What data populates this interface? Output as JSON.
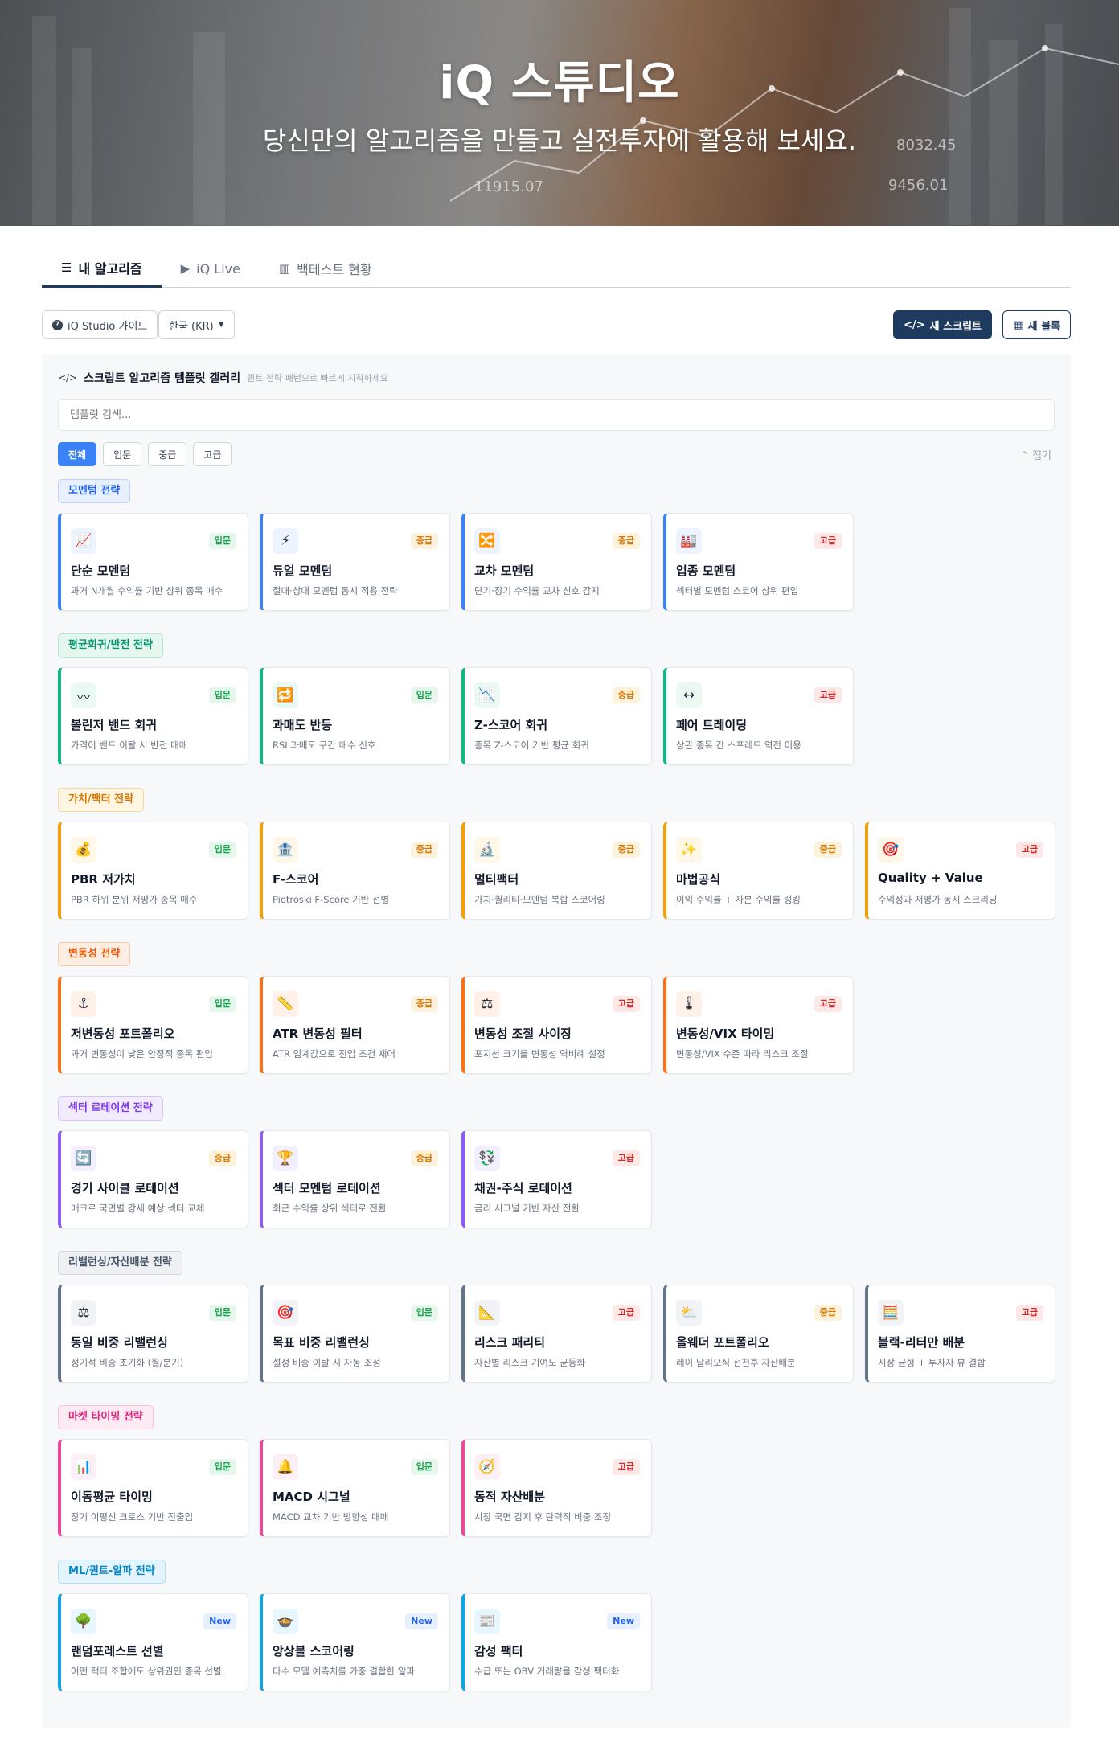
{
  "hero": {
    "title": "iQ 스튜디오",
    "subtitle": "당신만의 알고리즘을 만들고 실전투자에 활용해 보세요.",
    "bg_numbers": [
      "8032.45",
      "11915.07",
      "9456.01"
    ]
  },
  "tabs": [
    {
      "label": "내 알고리즘",
      "icon": "list-icon",
      "glyph": "☰"
    },
    {
      "label": "iQ Live",
      "icon": "play-circle-icon",
      "glyph": "▶"
    },
    {
      "label": "백테스트 현황",
      "icon": "bar-chart-icon",
      "glyph": "📊"
    }
  ],
  "toolbar": {
    "guide_label": "iQ Studio 가이드",
    "market_label": "한국 (KR)",
    "new_script_label": "새 스크립트",
    "new_block_label": "새 블록"
  },
  "gallery": {
    "title": "스크립트 알고리즘 템플릿 갤러리",
    "subtitle": "퀀트 전략 패턴으로 빠르게 시작하세요",
    "search_placeholder": "템플릿 검색...",
    "filters": [
      "전체",
      "입문",
      "중급",
      "고급"
    ],
    "collapse_label": "접기"
  },
  "colors": {
    "momentum": "#3b82f6",
    "mean_reversion": "#10b981",
    "value": "#f59e0b",
    "volatility": "#f97316",
    "sector": "#8b5cf6",
    "rebalance": "#64748b",
    "timing": "#ec4899",
    "ml": "#0ea5e9"
  },
  "categories": [
    {
      "name": "모멘텀 전략",
      "theme": "momentum",
      "cards": [
        {
          "icon": "chart-increasing-icon",
          "glyph": "📈",
          "level": "입문",
          "lv": "basic",
          "title": "단순 모멘텀",
          "desc": "과거 N개월 수익률 기반 상위 종목 매수"
        },
        {
          "icon": "lightning-icon",
          "glyph": "⚡",
          "level": "중급",
          "lv": "mid",
          "title": "듀얼 모멘텀",
          "desc": "절대·상대 모멘텀 동시 적용 전략"
        },
        {
          "icon": "shuffle-icon",
          "glyph": "🔀",
          "level": "중급",
          "lv": "mid",
          "title": "교차 모멘텀",
          "desc": "단기·장기 수익률 교차 신호 감지"
        },
        {
          "icon": "factory-icon",
          "glyph": "🏭",
          "level": "고급",
          "lv": "adv",
          "title": "업종 모멘텀",
          "desc": "섹터별 모멘텀 스코어 상위 편입"
        }
      ]
    },
    {
      "name": "평균회귀/반전 전략",
      "theme": "mean_reversion",
      "cards": [
        {
          "icon": "wave-icon",
          "glyph": "〰",
          "level": "입문",
          "lv": "basic",
          "title": "볼린저 밴드 회귀",
          "desc": "가격이 밴드 이탈 시 반전 매매"
        },
        {
          "icon": "repeat-icon",
          "glyph": "🔁",
          "level": "입문",
          "lv": "basic",
          "title": "과매도 반등",
          "desc": "RSI 과매도 구간 매수 신호"
        },
        {
          "icon": "chart-decreasing-icon",
          "glyph": "📉",
          "level": "중급",
          "lv": "mid",
          "title": "Z-스코어 회귀",
          "desc": "종목 Z-스코어 기반 평균 회귀"
        },
        {
          "icon": "left-right-arrow-icon",
          "glyph": "↔",
          "level": "고급",
          "lv": "adv",
          "title": "페어 트레이딩",
          "desc": "상관 종목 간 스프레드 역전 이용"
        }
      ]
    },
    {
      "name": "가치/팩터 전략",
      "theme": "value",
      "cards": [
        {
          "icon": "money-bag-icon",
          "glyph": "💰",
          "level": "입문",
          "lv": "basic",
          "title": "PBR 저가치",
          "desc": "PBR 하위 분위 저평가 종목 매수"
        },
        {
          "icon": "bank-icon",
          "glyph": "🏦",
          "level": "중급",
          "lv": "mid",
          "title": "F-스코어",
          "desc": "Piotroski F-Score 기반 선별"
        },
        {
          "icon": "microscope-icon",
          "glyph": "🔬",
          "level": "중급",
          "lv": "mid",
          "title": "멀티팩터",
          "desc": "가치·퀄리티·모멘텀 복합 스코어링"
        },
        {
          "icon": "sparkles-icon",
          "glyph": "✨",
          "level": "중급",
          "lv": "mid",
          "title": "마법공식",
          "desc": "이익 수익률 + 자본 수익률 랭킹"
        },
        {
          "icon": "target-icon",
          "glyph": "🎯",
          "level": "고급",
          "lv": "adv",
          "title": "Quality + Value",
          "desc": "수익성과 저평가 동시 스크리닝"
        }
      ]
    },
    {
      "name": "변동성 전략",
      "theme": "volatility",
      "cards": [
        {
          "icon": "anchor-icon",
          "glyph": "⚓",
          "level": "입문",
          "lv": "basic",
          "title": "저변동성 포트폴리오",
          "desc": "과거 변동성이 낮은 안정적 종목 편입"
        },
        {
          "icon": "ruler-icon",
          "glyph": "📏",
          "level": "중급",
          "lv": "mid",
          "title": "ATR 변동성 필터",
          "desc": "ATR 임계값으로 진입 조건 제어"
        },
        {
          "icon": "balance-scale-icon",
          "glyph": "⚖",
          "level": "고급",
          "lv": "adv",
          "title": "변동성 조절 사이징",
          "desc": "포지션 크기를 변동성 역비례 설정"
        },
        {
          "icon": "thermometer-icon",
          "glyph": "🌡",
          "level": "고급",
          "lv": "adv",
          "title": "변동성/VIX 타이밍",
          "desc": "변동성/VIX 수준 따라 리스크 조절"
        }
      ]
    },
    {
      "name": "섹터 로테이션 전략",
      "theme": "sector",
      "cards": [
        {
          "icon": "cycle-arrows-icon",
          "glyph": "🔄",
          "level": "중급",
          "lv": "mid",
          "title": "경기 사이클 로테이션",
          "desc": "매크로 국면별 강세 예상 섹터 교체"
        },
        {
          "icon": "trophy-icon",
          "glyph": "🏆",
          "level": "중급",
          "lv": "mid",
          "title": "섹터 모멘텀 로테이션",
          "desc": "최근 수익률 상위 섹터로 전환"
        },
        {
          "icon": "currency-exchange-icon",
          "glyph": "💱",
          "level": "고급",
          "lv": "adv",
          "title": "채권-주식 로테이션",
          "desc": "금리 시그널 기반 자산 전환"
        }
      ]
    },
    {
      "name": "리밸런싱/자산배분 전략",
      "theme": "rebalance",
      "cards": [
        {
          "icon": "balance-scale-icon",
          "glyph": "⚖",
          "level": "입문",
          "lv": "basic",
          "title": "동일 비중 리밸런싱",
          "desc": "정기적 비중 초기화 (월/분기)"
        },
        {
          "icon": "target-icon",
          "glyph": "🎯",
          "level": "입문",
          "lv": "basic",
          "title": "목표 비중 리밸런싱",
          "desc": "설정 비중 이탈 시 자동 조정"
        },
        {
          "icon": "triangle-ruler-icon",
          "glyph": "📐",
          "level": "고급",
          "lv": "adv",
          "title": "리스크 패리티",
          "desc": "자산별 리스크 기여도 균등화"
        },
        {
          "icon": "sun-cloud-icon",
          "glyph": "⛅",
          "level": "중급",
          "lv": "mid",
          "title": "올웨더 포트폴리오",
          "desc": "레이 달리오식 전천후 자산배분"
        },
        {
          "icon": "abacus-icon",
          "glyph": "🧮",
          "level": "고급",
          "lv": "adv",
          "title": "블랙-리터만 배분",
          "desc": "시장 균형 + 투자자 뷰 결합"
        }
      ]
    },
    {
      "name": "마켓 타이밍 전략",
      "theme": "timing",
      "cards": [
        {
          "icon": "bar-chart-icon",
          "glyph": "📊",
          "level": "입문",
          "lv": "basic",
          "title": "이동평균 타이밍",
          "desc": "장기 이평선 크로스 기반 진출입"
        },
        {
          "icon": "bell-icon",
          "glyph": "🔔",
          "level": "입문",
          "lv": "basic",
          "title": "MACD 시그널",
          "desc": "MACD 교차 기반 방향성 매매"
        },
        {
          "icon": "compass-icon",
          "glyph": "🧭",
          "level": "고급",
          "lv": "adv",
          "title": "동적 자산배분",
          "desc": "시장 국면 감지 후 탄력적 비중 조정"
        }
      ]
    },
    {
      "name": "ML/퀀트-알파 전략",
      "theme": "ml",
      "cards": [
        {
          "icon": "tree-icon",
          "glyph": "🌳",
          "level": "New",
          "lv": "new",
          "title": "랜덤포레스트 선별",
          "desc": "어떤 팩터 조합에도 상위권인 종목 선별"
        },
        {
          "icon": "bowl-icon",
          "glyph": "🍲",
          "level": "New",
          "lv": "new",
          "title": "앙상블 스코어링",
          "desc": "다수 모델 예측치를 가중 결합한 알파"
        },
        {
          "icon": "newspaper-icon",
          "glyph": "📰",
          "level": "New",
          "lv": "new",
          "title": "감성 팩터",
          "desc": "수급 또는 OBV 거래량을 감성 팩터화"
        }
      ]
    }
  ]
}
